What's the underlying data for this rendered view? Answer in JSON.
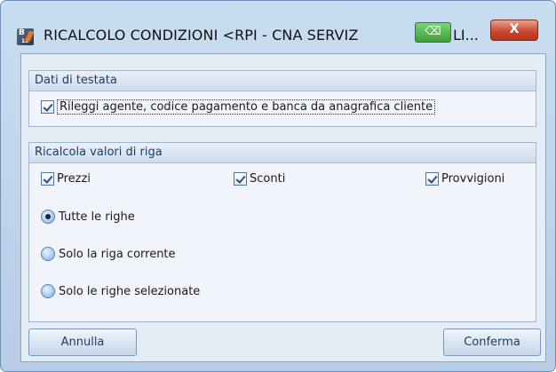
{
  "window": {
    "title": "RICALCOLO CONDIZIONI <RPI - CNA SERVIZ",
    "title_tail": "LI...",
    "icon_text": "B",
    "icon_sub": "15",
    "close_symbol": "X",
    "pin_symbol": "⌫",
    "close_color": "#c9492f",
    "pin_color": "#3f9e3a"
  },
  "header_group": {
    "title": "Dati di testata",
    "reload_checkbox": {
      "label": "Rileggi agente, codice pagamento e banca da anagrafica cliente",
      "checked": true
    }
  },
  "row_group": {
    "title": "Ricalcola valori di riga",
    "checkboxes": [
      {
        "label": "Prezzi",
        "checked": true
      },
      {
        "label": "Sconti",
        "checked": true
      },
      {
        "label": "Provvigioni",
        "checked": true
      }
    ],
    "radios": [
      {
        "label": "Tutte le righe",
        "selected": true
      },
      {
        "label": "Solo la riga corrente",
        "selected": false
      },
      {
        "label": "Solo le righe selezionate",
        "selected": false
      }
    ]
  },
  "buttons": {
    "cancel": "Annulla",
    "confirm": "Conferma"
  }
}
